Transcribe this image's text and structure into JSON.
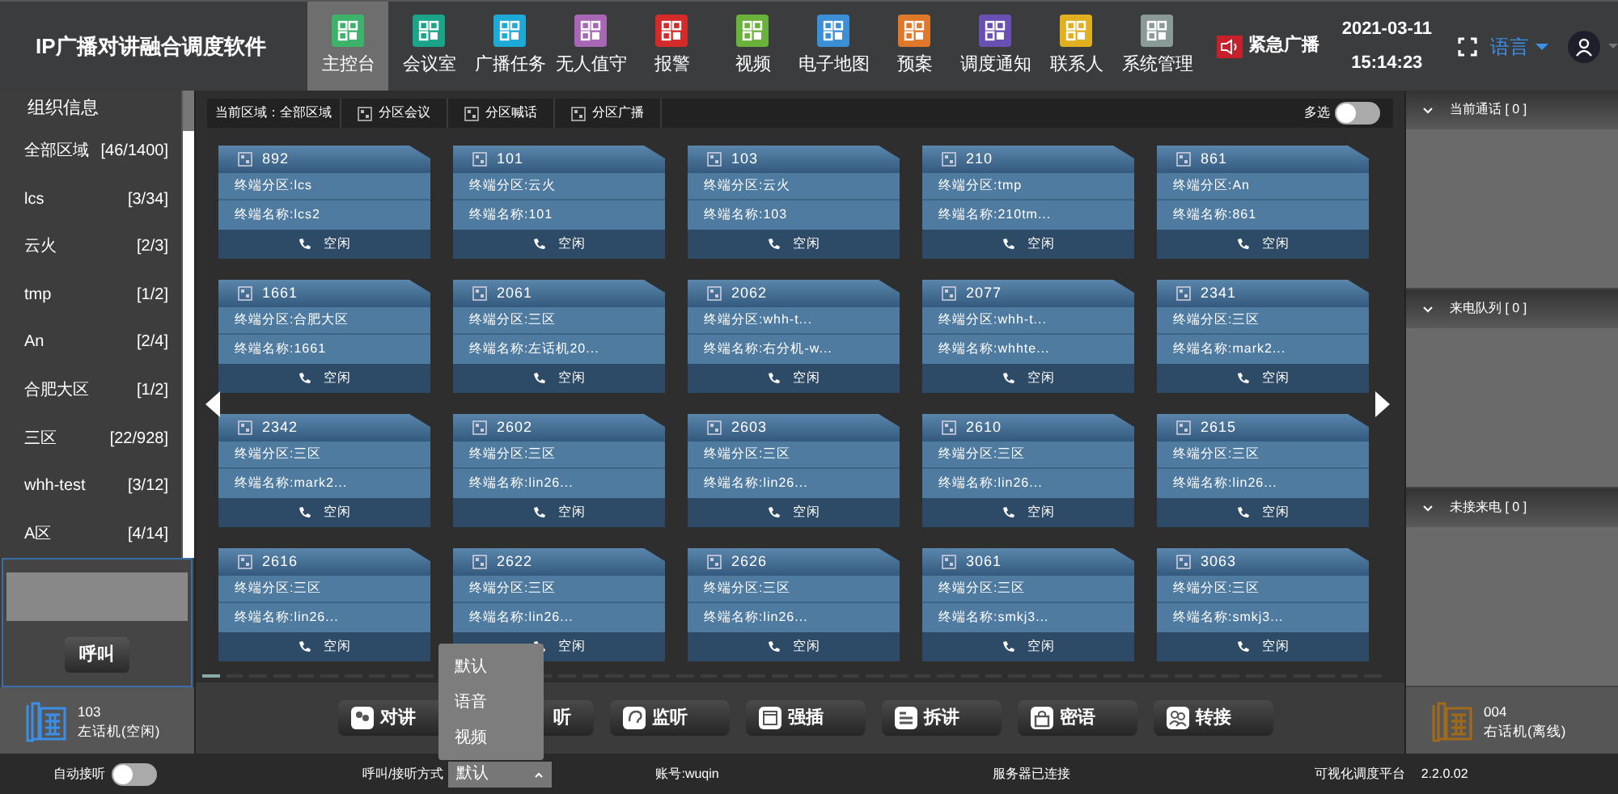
{
  "app_title": "IP广播对讲融合调度软件",
  "nav": [
    {
      "label": "主控台",
      "color": "#3bb36b",
      "selected": true
    },
    {
      "label": "会议室",
      "color": "#1aa58b",
      "selected": false
    },
    {
      "label": "广播任务",
      "color": "#1eaad6",
      "selected": false
    },
    {
      "label": "无人值守",
      "color": "#a867b5",
      "selected": false
    },
    {
      "label": "报警",
      "color": "#d42a2a",
      "selected": false
    },
    {
      "label": "视频",
      "color": "#6ab23a",
      "selected": false
    },
    {
      "label": "电子地图",
      "color": "#3a8fd6",
      "selected": false
    },
    {
      "label": "预案",
      "color": "#e0782a",
      "selected": false
    },
    {
      "label": "调度通知",
      "color": "#6a4fb5",
      "selected": false
    },
    {
      "label": "联系人",
      "color": "#e0b020",
      "selected": false
    },
    {
      "label": "系统管理",
      "color": "#8a9a96",
      "selected": false
    }
  ],
  "emergency_button": "紧急广播",
  "date": "2021-03-11",
  "time": "15:14:23",
  "language": "语言",
  "sidebar": {
    "title": "组织信息",
    "items": [
      {
        "name": "全部区域",
        "count": "[46/1400]"
      },
      {
        "name": "lcs",
        "count": "[3/34]"
      },
      {
        "name": "云火",
        "count": "[2/3]"
      },
      {
        "name": "tmp",
        "count": "[1/2]"
      },
      {
        "name": "An",
        "count": "[2/4]"
      },
      {
        "name": "合肥大区",
        "count": "[1/2]"
      },
      {
        "name": "三区",
        "count": "[22/928]"
      },
      {
        "name": "whh-test",
        "count": "[3/12]"
      },
      {
        "name": "A区",
        "count": "[4/14]"
      }
    ],
    "call_button": "呼叫",
    "phone": {
      "number": "103",
      "label": "左话机(空闲)"
    }
  },
  "toolbar": {
    "current_area": "当前区域：全部区域",
    "actions": [
      "分区会议",
      "分区喊话",
      "分区广播"
    ],
    "multi_select": {
      "label": "多选",
      "on": false
    }
  },
  "terminals": [
    {
      "id": "892",
      "zone": "终端分区:lcs",
      "name": "终端名称:lcs2",
      "status": "空闲"
    },
    {
      "id": "101",
      "zone": "终端分区:云火",
      "name": "终端名称:101",
      "status": "空闲"
    },
    {
      "id": "103",
      "zone": "终端分区:云火",
      "name": "终端名称:103",
      "status": "空闲"
    },
    {
      "id": "210",
      "zone": "终端分区:tmp",
      "name": "终端名称:210tm...",
      "status": "空闲"
    },
    {
      "id": "861",
      "zone": "终端分区:An",
      "name": "终端名称:861",
      "status": "空闲"
    },
    {
      "id": "1661",
      "zone": "终端分区:合肥大区",
      "name": "终端名称:1661",
      "status": "空闲"
    },
    {
      "id": "2061",
      "zone": "终端分区:三区",
      "name": "终端名称:左话机20...",
      "status": "空闲"
    },
    {
      "id": "2062",
      "zone": "终端分区:whh-t...",
      "name": "终端名称:右分机-w...",
      "status": "空闲"
    },
    {
      "id": "2077",
      "zone": "终端分区:whh-t...",
      "name": "终端名称:whhte...",
      "status": "空闲"
    },
    {
      "id": "2341",
      "zone": "终端分区:三区",
      "name": "终端名称:mark2...",
      "status": "空闲"
    },
    {
      "id": "2342",
      "zone": "终端分区:三区",
      "name": "终端名称:mark2...",
      "status": "空闲"
    },
    {
      "id": "2602",
      "zone": "终端分区:三区",
      "name": "终端名称:lin26...",
      "status": "空闲"
    },
    {
      "id": "2603",
      "zone": "终端分区:三区",
      "name": "终端名称:lin26...",
      "status": "空闲"
    },
    {
      "id": "2610",
      "zone": "终端分区:三区",
      "name": "终端名称:lin26...",
      "status": "空闲"
    },
    {
      "id": "2615",
      "zone": "终端分区:三区",
      "name": "终端名称:lin26...",
      "status": "空闲"
    },
    {
      "id": "2616",
      "zone": "终端分区:三区",
      "name": "终端名称:lin26...",
      "status": "空闲"
    },
    {
      "id": "2622",
      "zone": "终端分区:三区",
      "name": "终端名称:lin26...",
      "status": "空闲"
    },
    {
      "id": "2626",
      "zone": "终端分区:三区",
      "name": "终端名称:lin26...",
      "status": "空闲"
    },
    {
      "id": "3061",
      "zone": "终端分区:三区",
      "name": "终端名称:smkj3...",
      "status": "空闲"
    },
    {
      "id": "3063",
      "zone": "终端分区:三区",
      "name": "终端名称:smkj3...",
      "status": "空闲"
    }
  ],
  "actions": [
    {
      "label": "对讲",
      "kind": "talk"
    },
    {
      "label": "听",
      "kind": "plain"
    },
    {
      "label": "监听",
      "kind": "listen"
    },
    {
      "label": "强插",
      "kind": "insert"
    },
    {
      "label": "拆讲",
      "kind": "split"
    },
    {
      "label": "密语",
      "kind": "lock"
    },
    {
      "label": "转接",
      "kind": "transfer"
    }
  ],
  "right_panel": {
    "sections": [
      "当前通话 [ 0 ]",
      "来电队列 [ 0 ]",
      "未接来电 [ 0 ]"
    ],
    "phone": {
      "number": "004",
      "label": "右话机(离线)"
    }
  },
  "status_bar": {
    "auto_answer": {
      "label": "自动接听",
      "on": false
    },
    "call_mode": {
      "label": "呼叫/接听方式",
      "value": "默认",
      "expanded": true,
      "options": [
        "默认",
        "语音",
        "视频"
      ]
    },
    "account": "账号:wuqin",
    "server": "服务器已连接",
    "platform": "可视化调度平台",
    "version": "2.2.0.02"
  }
}
